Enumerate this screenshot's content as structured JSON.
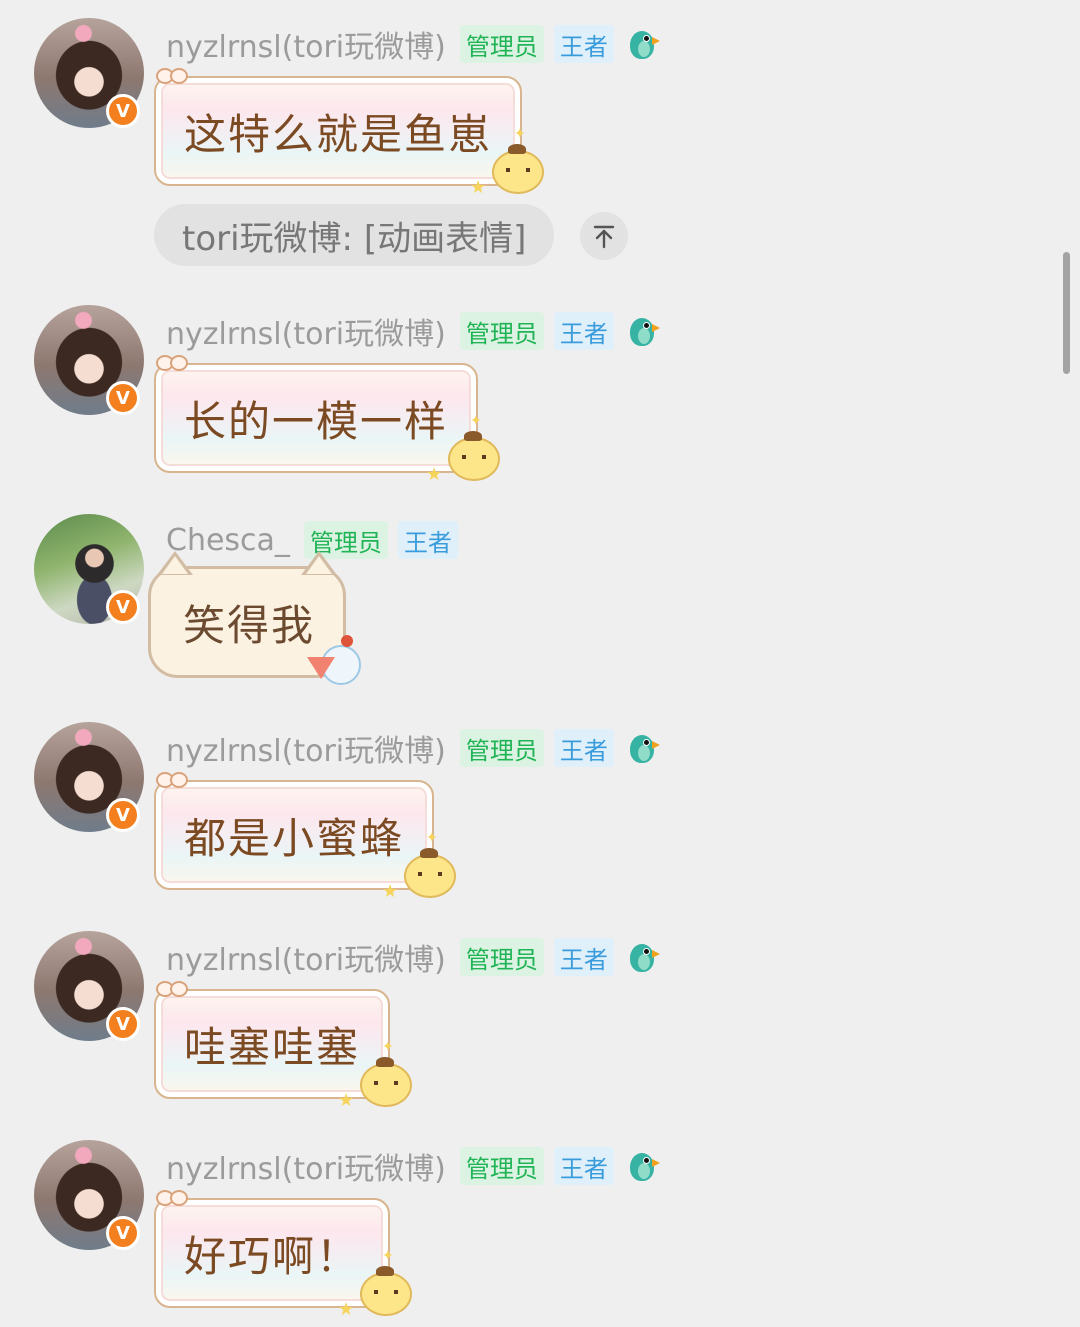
{
  "messages": [
    {
      "username": "nyzlrnsl(tori玩微博)",
      "tags": {
        "admin": "管理员",
        "king": "王者"
      },
      "verified_badge": "V",
      "text": "这特么就是鱼崽",
      "avatar_icon": "girl-avatar",
      "bubble_style": "pompompurin",
      "quote": "tori玩微博: [动画表情]"
    },
    {
      "username": "nyzlrnsl(tori玩微博)",
      "tags": {
        "admin": "管理员",
        "king": "王者"
      },
      "verified_badge": "V",
      "text": "长的一模一样",
      "avatar_icon": "girl-avatar",
      "bubble_style": "pompompurin"
    },
    {
      "username": "Chesca_",
      "tags": {
        "admin": "管理员",
        "king": "王者"
      },
      "verified_badge": "V",
      "text": "笑得我",
      "avatar_icon": "chesca-avatar",
      "bubble_style": "cat"
    },
    {
      "username": "nyzlrnsl(tori玩微博)",
      "tags": {
        "admin": "管理员",
        "king": "王者"
      },
      "verified_badge": "V",
      "text": "都是小蜜蜂",
      "avatar_icon": "girl-avatar",
      "bubble_style": "pompompurin"
    },
    {
      "username": "nyzlrnsl(tori玩微博)",
      "tags": {
        "admin": "管理员",
        "king": "王者"
      },
      "verified_badge": "V",
      "text": "哇塞哇塞",
      "avatar_icon": "girl-avatar",
      "bubble_style": "pompompurin"
    },
    {
      "username": "nyzlrnsl(tori玩微博)",
      "tags": {
        "admin": "管理员",
        "king": "王者"
      },
      "verified_badge": "V",
      "text": "好巧啊！",
      "avatar_icon": "girl-avatar",
      "bubble_style": "pompompurin"
    }
  ],
  "colors": {
    "background": "#efefef",
    "admin_tag_bg": "#dcf3e3",
    "admin_tag_text": "#21b456",
    "king_tag_bg": "#dff0fb",
    "king_tag_text": "#3b9cdc",
    "verified_badge": "#f37f1e",
    "bubble_text": "#7b4a22"
  }
}
